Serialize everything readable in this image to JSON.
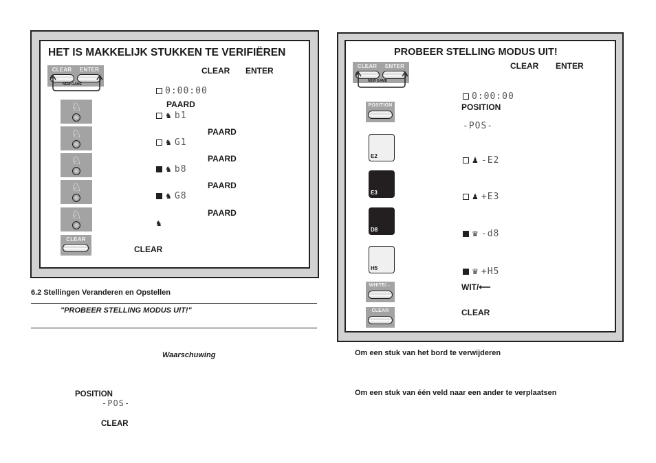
{
  "left_panel": {
    "title": "HET IS MAKKELIJK STUKKEN TE VERIFIËREN",
    "keys": {
      "clear": "CLEAR",
      "enter": "ENTER",
      "new_game": "NEW GAME",
      "knight_icon": "♘",
      "clear_key": "CLEAR"
    },
    "header_labels": {
      "clear": "CLEAR",
      "enter": "ENTER"
    },
    "steps": [
      {
        "display": "0:00:00",
        "box": "empty",
        "piece": ""
      },
      {
        "label": "PAARD",
        "display": "b1",
        "box": "empty",
        "piece": "♞"
      },
      {
        "label": "PAARD",
        "display": "G1",
        "box": "empty",
        "piece": "♞"
      },
      {
        "label": "PAARD",
        "display": "b8",
        "box": "filled",
        "piece": "♞"
      },
      {
        "label": "PAARD",
        "display": "G8",
        "box": "filled",
        "piece": "♞"
      },
      {
        "label": "PAARD",
        "display": "",
        "box": "none",
        "piece": "♞"
      }
    ],
    "clear_label": "CLEAR"
  },
  "section": {
    "heading": "6.2 Stellingen Veranderen en Opstellen",
    "quote": "\"PROBEER STELLING MODUS UIT!\"",
    "warning": "Waarschuwing",
    "position_label": "POSITION",
    "pos_display": "-POS-",
    "clear_label": "CLEAR"
  },
  "right_panel": {
    "title": "PROBEER STELLING MODUS UIT!",
    "keys": {
      "clear": "CLEAR",
      "enter": "ENTER",
      "new_game": "NEW GAME",
      "position": "POSITION",
      "white": "WHITE/←",
      "clear_key": "CLEAR"
    },
    "header_labels": {
      "clear": "CLEAR",
      "enter": "ENTER"
    },
    "timer_display": "0:00:00",
    "position_label": "POSITION",
    "pos_display": "-POS-",
    "squares": [
      {
        "name": "E2",
        "shade": "light",
        "box": "empty",
        "piece": "♟",
        "display": "-E2"
      },
      {
        "name": "E3",
        "shade": "dark",
        "box": "empty",
        "piece": "♟",
        "display": "+E3"
      },
      {
        "name": "D8",
        "shade": "dark",
        "box": "filled",
        "piece": "♛",
        "display": "-d8"
      },
      {
        "name": "H5",
        "shade": "light",
        "box": "filled",
        "piece": "♛",
        "display": "+H5"
      }
    ],
    "white_label": "WIT/⟵",
    "clear_label": "CLEAR"
  },
  "notes": {
    "remove_piece": "Om een stuk van het bord te verwijderen",
    "move_piece": "Om een stuk van één veld naar een ander te verplaatsen"
  }
}
